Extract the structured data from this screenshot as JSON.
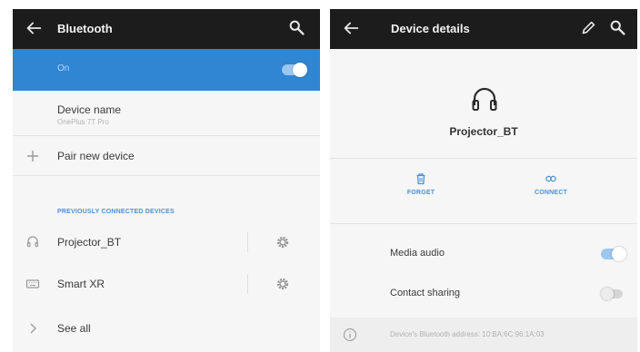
{
  "colors": {
    "accent": "#2f86d3",
    "appbar": "#1c1c1c",
    "link": "#4b90d6"
  },
  "bluetooth_screen": {
    "title": "Bluetooth",
    "back_icon": "arrow-left-icon",
    "search_icon": "search-icon",
    "toggle": {
      "label": "On",
      "state": true
    },
    "device_name": {
      "label": "Device name",
      "value": "OnePlus 7T Pro"
    },
    "pair_new_device": "Pair new device",
    "section_header": "PREVIOUSLY CONNECTED DEVICES",
    "devices": [
      {
        "name": "Projector_BT",
        "icon": "headphones-icon"
      },
      {
        "name": "Smart XR",
        "icon": "keyboard-icon"
      }
    ],
    "see_all": "See all"
  },
  "details_screen": {
    "title": "Device details",
    "device_name": "Projector_BT",
    "actions": {
      "forget": "FORGET",
      "connect": "CONNECT"
    },
    "settings": [
      {
        "label": "Media audio",
        "enabled": true
      },
      {
        "label": "Contact sharing",
        "enabled": false
      }
    ],
    "address_text": "Device's Bluetooth address: 10:BA:6C:96:1A:03"
  }
}
